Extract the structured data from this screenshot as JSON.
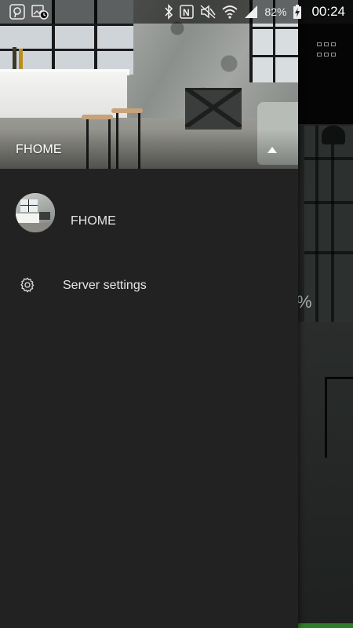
{
  "status_bar": {
    "battery_percent": "82%",
    "time": "00:24",
    "icons": [
      "pinterest-icon",
      "image-alarm-icon",
      "bluetooth-icon",
      "nfc-icon",
      "mute-icon",
      "wifi-icon",
      "signal-icon",
      "battery-charging-icon"
    ]
  },
  "background_app": {
    "percent_symbol": "%",
    "toolbar_icon": "grid-icon",
    "accent_green": "#2e7d2a"
  },
  "drawer": {
    "header": {
      "account_name": "FHOME",
      "toggle_icon": "triangle-up-icon"
    },
    "items": [
      {
        "label": "FHOME",
        "icon": "avatar-kitchen-image"
      },
      {
        "label": "Server settings",
        "icon": "gear-icon"
      }
    ]
  },
  "colors": {
    "drawer_bg": "#222222",
    "text_primary": "#e6e6e6"
  }
}
